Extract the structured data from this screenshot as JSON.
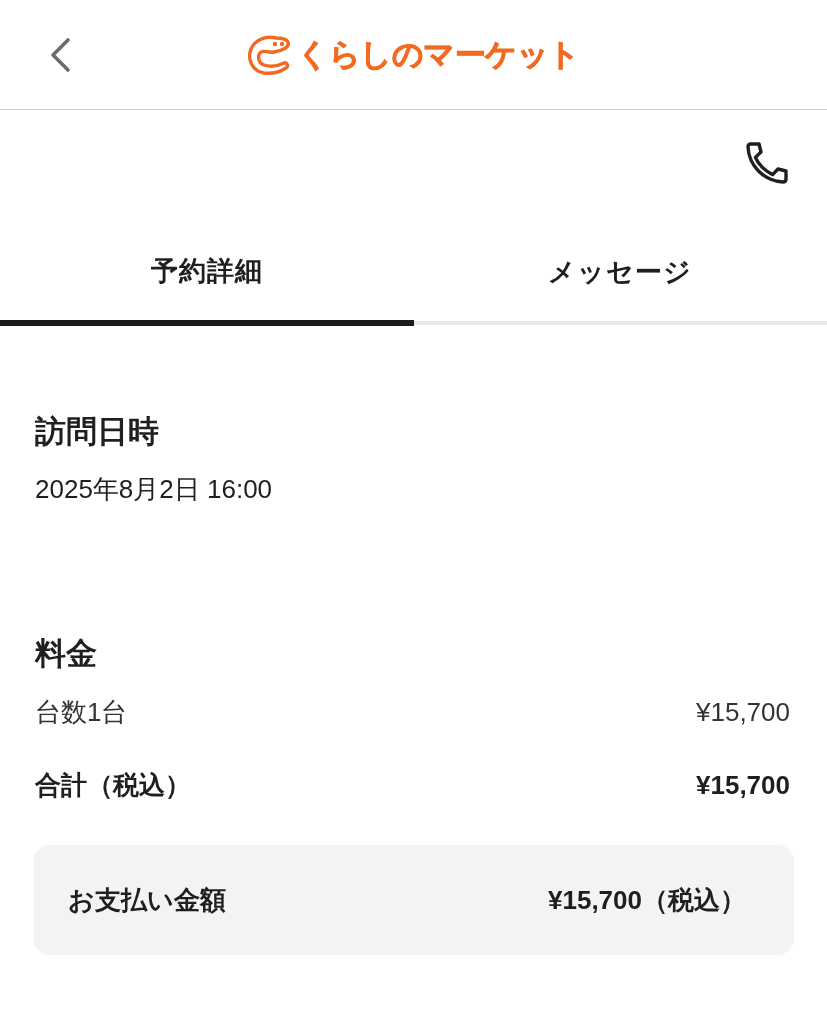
{
  "header": {
    "logo_text": "くらしのマーケット"
  },
  "tabs": [
    {
      "label": "予約詳細",
      "selected": true
    },
    {
      "label": "メッセージ",
      "selected": false
    }
  ],
  "visit": {
    "heading": "訪問日時",
    "datetime": "2025年8月2日 16:00"
  },
  "fee": {
    "heading": "料金",
    "items": [
      {
        "kind": "line",
        "label": "台数1台",
        "amount": "¥15,700"
      },
      {
        "kind": "total",
        "label": "合計（税込）",
        "amount": "¥15,700"
      }
    ]
  },
  "payment": {
    "label": "お支払い金額",
    "amount": "¥15,700（税込）"
  }
}
